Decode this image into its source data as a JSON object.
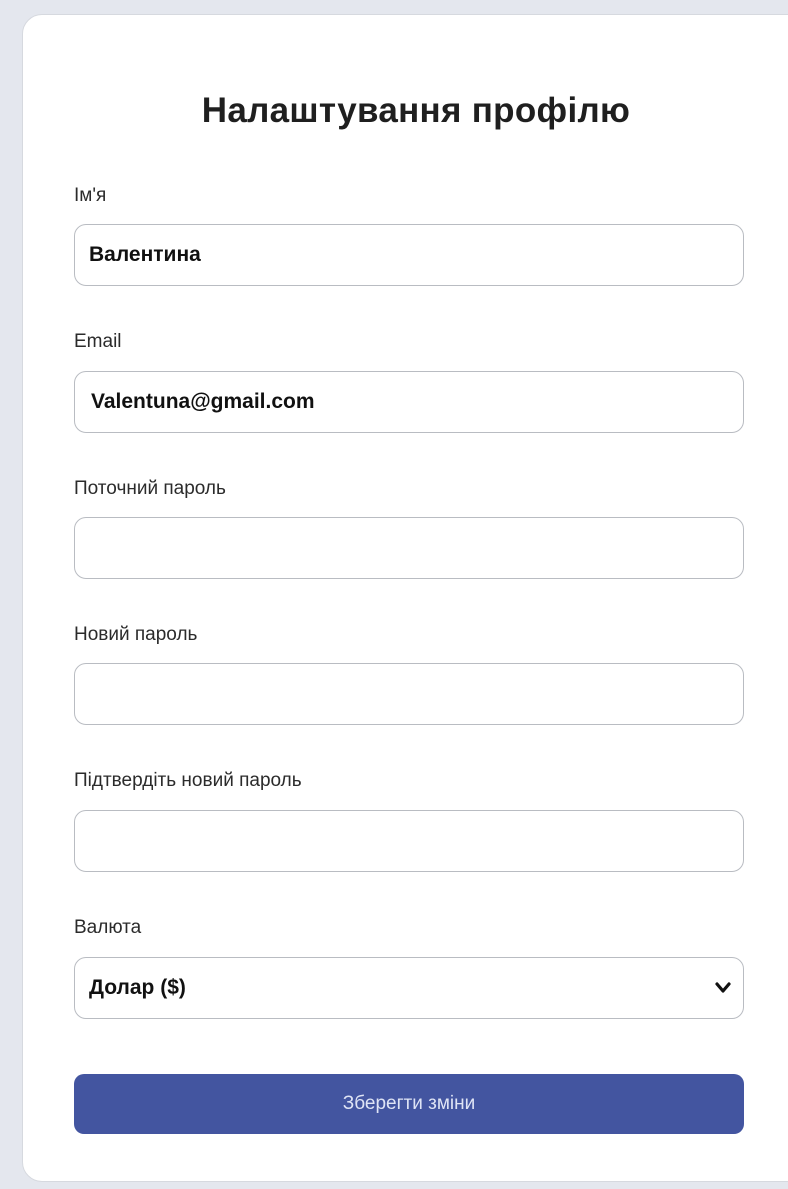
{
  "page": {
    "title": "Налаштування профілю"
  },
  "form": {
    "name": {
      "label": "Ім'я",
      "value": "Валентина"
    },
    "email": {
      "label": "Email",
      "value": "Valentuna@gmail.com"
    },
    "current_password": {
      "label": "Поточний пароль",
      "value": ""
    },
    "new_password": {
      "label": "Новий пароль",
      "value": ""
    },
    "confirm_password": {
      "label": "Підтвердіть новий пароль",
      "value": ""
    },
    "currency": {
      "label": "Валюта",
      "selected": "Долар ($)",
      "icon": "chevron-down-icon"
    },
    "save_label": "Зберегти зміни"
  },
  "colors": {
    "accent": "#4355a0",
    "button_text": "#dfe4f5",
    "background": "#e4e7ee",
    "card": "#ffffff"
  }
}
